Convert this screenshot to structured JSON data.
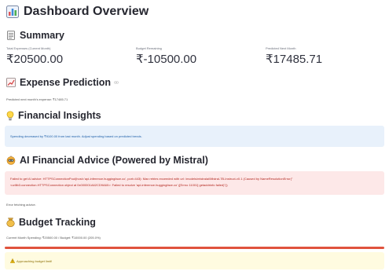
{
  "header": {
    "title": "Dashboard Overview",
    "icon": "bar-chart-icon"
  },
  "summary": {
    "heading": "Summary",
    "icon": "memo-icon",
    "metrics": [
      {
        "label": "Total Expenses (Current Month)",
        "value": "₹20500.00"
      },
      {
        "label": "Budget Remaining",
        "value": "₹-10500.00"
      },
      {
        "label": "Predicted Next Month",
        "value": "₹17485.71"
      }
    ]
  },
  "prediction": {
    "heading": "Expense Prediction",
    "icon": "chart-upward-icon",
    "link_icon": "link-icon",
    "text": "Predicted next month's expense: ₹17485.71"
  },
  "insights": {
    "heading": "Financial Insights",
    "icon": "lightbulb-icon",
    "message": "Spending decreased by ₹9100.00 from last month. Adjust spending based on predicted trends."
  },
  "advice": {
    "heading": "AI Financial Advice (Powered by Mistral)",
    "icon": "robot-icon",
    "error_line1": "Failed to get AI advice: HTTPSConnectionPool(host='api-inference.huggingface.co', port=443): Max retries exceeded with url: /models/mistralai/Mistral-7B-Instruct-v0.1 (Caused by NameResolutionError(\"",
    "error_line2": "<urllib3.connection.HTTPSConnection object at 0x000001A62CD9A60>: Failed to resolve 'api-inference.huggingface.co' ([Errno 11001] getaddrinfo failed)\"))",
    "fallback": "Error fetching advice."
  },
  "budget": {
    "heading": "Budget Tracking",
    "icon": "money-bag-icon",
    "status": "Current Month Spending: ₹20500.00 / Budget: ₹10000.00 (205.0%)",
    "progress_fraction": 1.0,
    "warning": "Approaching budget limit!",
    "warning_icon": "warning-icon"
  },
  "colors": {
    "progress": "#e0533d",
    "info_bg": "#e8f1fb",
    "info_text": "#1c5ea8",
    "error_bg": "#fde8e8",
    "error_text": "#b3261e",
    "warn_bg": "#fffbe0",
    "warn_text": "#8a6d00"
  }
}
